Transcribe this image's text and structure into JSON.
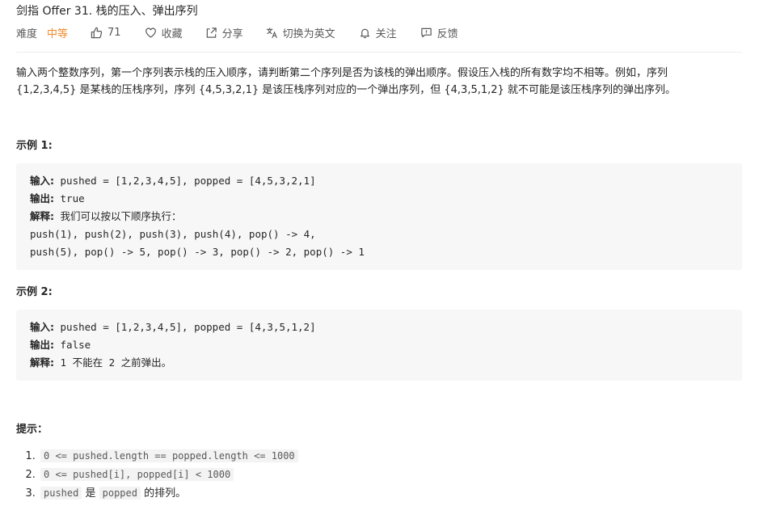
{
  "title": "剑指 Offer 31. 栈的压入、弹出序列",
  "meta": {
    "difficulty_label": "难度",
    "difficulty_value": "中等",
    "likes": "71",
    "favorite": "收藏",
    "share": "分享",
    "switch_lang": "切换为英文",
    "follow": "关注",
    "feedback": "反馈"
  },
  "description": {
    "line1": "输入两个整数序列，第一个序列表示栈的压入顺序，请判断第二个序列是否为该栈的弹出顺序。假设压入栈的所有数字均不相等。例如，序列",
    "line2": "{1,2,3,4,5} 是某栈的压栈序列，序列 {4,5,3,2,1} 是该压栈序列对应的一个弹出序列，但 {4,3,5,1,2} 就不可能是该压栈序列的弹出序列。"
  },
  "example1": {
    "heading": "示例 1:",
    "input_label": "输入:",
    "input_value": " pushed = [1,2,3,4,5], popped = [4,5,3,2,1]",
    "output_label": "输出:",
    "output_value": " true",
    "explain_label": "解释:",
    "explain_value": " 我们可以按以下顺序执行：",
    "steps1": "push(1), push(2), push(3), push(4), pop() -> 4,",
    "steps2": "push(5), pop() -> 5, pop() -> 3, pop() -> 2, pop() -> 1"
  },
  "example2": {
    "heading": "示例 2:",
    "input_label": "输入:",
    "input_value": " pushed = [1,2,3,4,5], popped = [4,3,5,1,2]",
    "output_label": "输出:",
    "output_value": " false",
    "explain_label": "解释:",
    "explain_value": " 1 不能在 2 之前弹出。"
  },
  "hints": {
    "heading": "提示：",
    "item1_code": "0 <= pushed.length == popped.length <= 1000",
    "item2_code": "0 <= pushed[i], popped[i] < 1000",
    "item3_code_a": "pushed",
    "item3_text_mid": " 是 ",
    "item3_code_b": "popped",
    "item3_text_end": " 的排列。"
  }
}
